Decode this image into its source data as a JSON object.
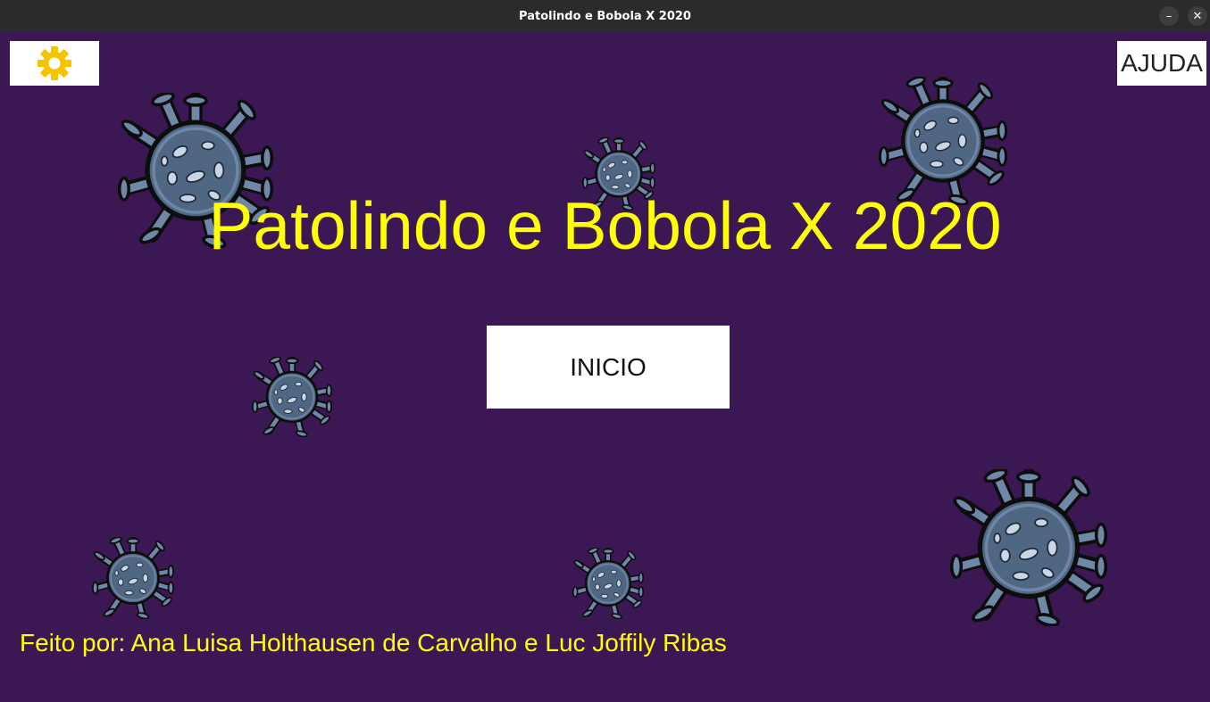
{
  "window": {
    "title": "Patolindo e Bobola X 2020"
  },
  "header": {
    "settings_icon": "gear-icon",
    "help_label": "AJUDA"
  },
  "main": {
    "title": "Patolindo e Bobola X 2020",
    "start_label": "INICIO"
  },
  "footer": {
    "credits": "Feito por: Ana Luisa Holthausen de Carvalho e Luc Joffily Ribas"
  },
  "colors": {
    "background": "#3b1753",
    "title": "#ffff00",
    "gear": "#f5c400",
    "virus_body": "#4f6782"
  }
}
